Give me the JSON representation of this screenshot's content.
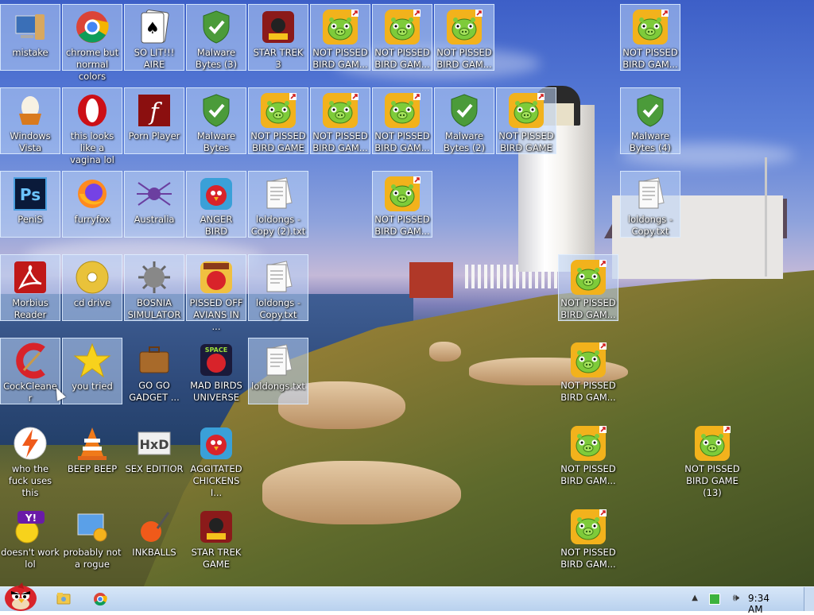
{
  "desktop": {
    "icons": [
      {
        "label": "mistake",
        "icon": "computer-icon"
      },
      {
        "label": "chrome but normal colors",
        "icon": "chrome-icon"
      },
      {
        "label": "SO LIT!!! AIRE",
        "icon": "solitaire-icon"
      },
      {
        "label": "Malware Bytes (3)",
        "icon": "shield-check-icon"
      },
      {
        "label": "STAR TREK 3",
        "icon": "star-wars-game-icon"
      },
      {
        "label": "NOT PISSED BIRD GAM...",
        "icon": "green-pig-icon"
      },
      {
        "label": "NOT PISSED BIRD GAM...",
        "icon": "green-pig-icon"
      },
      {
        "label": "NOT PISSED BIRD GAM...",
        "icon": "green-pig-icon"
      },
      {
        "label": "NOT PISSED BIRD GAM...",
        "icon": "green-pig-icon"
      },
      {
        "label": "Windows Vista",
        "icon": "egg-icon"
      },
      {
        "label": "this looks like a vagina lol",
        "icon": "opera-icon"
      },
      {
        "label": "Porn Player",
        "icon": "flash-icon"
      },
      {
        "label": "Malware Bytes",
        "icon": "shield-check-icon"
      },
      {
        "label": "NOT PISSED BIRD GAME",
        "icon": "green-pig-icon"
      },
      {
        "label": "NOT PISSED BIRD GAM...",
        "icon": "green-pig-icon"
      },
      {
        "label": "NOT PISSED BIRD GAM...",
        "icon": "green-pig-icon"
      },
      {
        "label": "Malware Bytes (2)",
        "icon": "shield-check-icon"
      },
      {
        "label": "NOT PISSED BIRD GAME",
        "icon": "green-pig-icon"
      },
      {
        "label": "Malware Bytes (4)",
        "icon": "shield-check-icon"
      },
      {
        "label": "PeniS",
        "icon": "photoshop-icon"
      },
      {
        "label": "furryfox",
        "icon": "firefox-icon"
      },
      {
        "label": "Australia",
        "icon": "spider-icon"
      },
      {
        "label": "ANGER BIRD",
        "icon": "red-bird-icon"
      },
      {
        "label": "loldongs - Copy (2).txt",
        "icon": "text-file-icon"
      },
      {
        "label": "NOT PISSED BIRD GAM...",
        "icon": "green-pig-icon"
      },
      {
        "label": "loldongs - Copy.txt",
        "icon": "text-file-icon"
      },
      {
        "label": "Morbius Reader",
        "icon": "acrobat-icon"
      },
      {
        "label": "cd drive",
        "icon": "cd-icon"
      },
      {
        "label": "BOSNIA SIMULATOR",
        "icon": "mine-icon"
      },
      {
        "label": "PISSED OFF AVIANS IN ...",
        "icon": "seasons-bird-icon"
      },
      {
        "label": "loldongs - Copy.txt",
        "icon": "text-file-icon"
      },
      {
        "label": "NOT PISSED BIRD GAM...",
        "icon": "green-pig-icon"
      },
      {
        "label": "CockCleaner",
        "icon": "ccleaner-icon"
      },
      {
        "label": "you tried",
        "icon": "star-icon"
      },
      {
        "label": "GO GO GADGET ...",
        "icon": "briefcase-icon"
      },
      {
        "label": "MAD BIRDS UNIVERSE",
        "icon": "space-bird-icon"
      },
      {
        "label": "loldongs.txt",
        "icon": "text-file-icon"
      },
      {
        "label": "NOT PISSED BIRD GAM...",
        "icon": "green-pig-icon"
      },
      {
        "label": "who the fuck uses this",
        "icon": "lightning-icon"
      },
      {
        "label": "BEEP BEEP",
        "icon": "traffic-cone-icon"
      },
      {
        "label": "SEX EDITIOR",
        "icon": "hxd-icon"
      },
      {
        "label": "AGGITATED CHICKENS I...",
        "icon": "red-bird-icon"
      },
      {
        "label": "NOT PISSED BIRD GAM...",
        "icon": "green-pig-icon"
      },
      {
        "label": "NOT PISSED BIRD GAME (13)",
        "icon": "green-pig-icon"
      },
      {
        "label": "doesn't work lol",
        "icon": "yahoo-icon"
      },
      {
        "label": "probably not a rogue",
        "icon": "monitor-gear-icon"
      },
      {
        "label": "INKBALLS",
        "icon": "inkball-icon"
      },
      {
        "label": "STAR TREK GAME",
        "icon": "star-wars-game-icon"
      },
      {
        "label": "NOT PISSED BIRD GAM...",
        "icon": "green-pig-icon"
      }
    ]
  },
  "taskbar": {
    "start_icon": "red-bird-icon",
    "pinned": [
      {
        "icon": "folder-icon"
      },
      {
        "icon": "chrome-icon"
      }
    ],
    "clock": "9:34 AM"
  },
  "colors": {
    "pig": "#7ecb3a",
    "badge": "#f2b21c",
    "shield": "#4b9b3a",
    "taskbar": "#c6dbf3"
  }
}
